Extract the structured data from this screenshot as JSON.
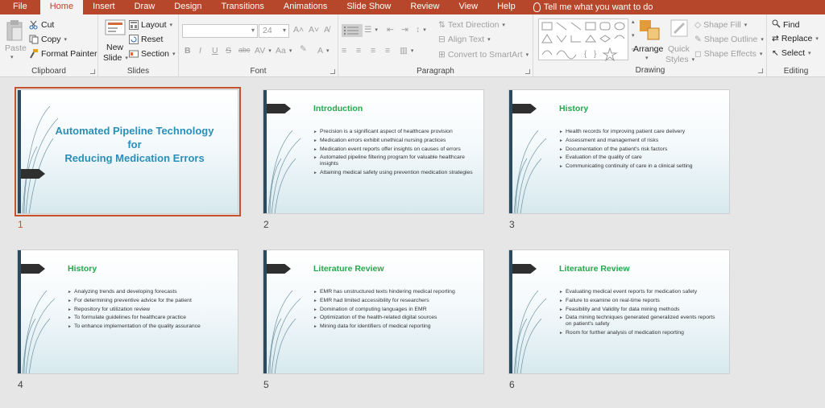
{
  "tabs": [
    "File",
    "Home",
    "Insert",
    "Draw",
    "Design",
    "Transitions",
    "Animations",
    "Slide Show",
    "Review",
    "View",
    "Help"
  ],
  "active_tab": "Home",
  "tell_me": "Tell me what you want to do",
  "clipboard": {
    "paste": "Paste",
    "cut": "Cut",
    "copy": "Copy",
    "format_painter": "Format Painter",
    "label": "Clipboard"
  },
  "slides_group": {
    "new_slide_1": "New",
    "new_slide_2": "Slide",
    "layout": "Layout",
    "reset": "Reset",
    "section": "Section",
    "label": "Slides"
  },
  "font": {
    "family_value": "",
    "size_value": "24",
    "label": "Font",
    "bold": "B",
    "italic": "I",
    "underline": "U",
    "strike": "S",
    "abc": "abc",
    "spacing": "AV",
    "case": "Aa",
    "color": "A"
  },
  "paragraph": {
    "text_direction": "Text Direction",
    "align_text": "Align Text",
    "convert_smartart": "Convert to SmartArt",
    "label": "Paragraph"
  },
  "drawing": {
    "arrange": "Arrange",
    "quick_styles_1": "Quick",
    "quick_styles_2": "Styles",
    "shape_fill": "Shape Fill",
    "shape_outline": "Shape Outline",
    "shape_effects": "Shape Effects",
    "label": "Drawing"
  },
  "editing": {
    "find": "Find",
    "replace": "Replace",
    "select": "Select",
    "label": "Editing"
  },
  "slides": [
    {
      "number": "1",
      "title_lines": [
        "Automated Pipeline Technology",
        "for",
        "Reducing Medication Errors"
      ],
      "selected": true
    },
    {
      "number": "2",
      "title": "Introduction",
      "bullets": [
        "Precision is a significant aspect of healthcare provision",
        "Medication errors exhibit unethical nursing practices",
        "Medication event reports offer insights on causes of errors",
        "Automated pipeline filtering program for valuable healthcare insights",
        "Attaining medical safety using prevention medication strategies"
      ]
    },
    {
      "number": "3",
      "title": "History",
      "bullets": [
        "Health records for improving patient care delivery",
        "Assessment and management of risks",
        "Documentation of the patient's risk factors",
        "Evaluation of the quality of care",
        "Communicating continuity of care in a clinical setting"
      ]
    },
    {
      "number": "4",
      "title": "History",
      "bullets": [
        "Analyzing trends and developing forecasts",
        "For determining preventive advice for the patient",
        "Repository for utilization review",
        "To formulate guidelines for healthcare practice",
        "To enhance implementation of the quality assurance"
      ]
    },
    {
      "number": "5",
      "title": "Literature Review",
      "bullets": [
        "EMR has unstructured texts hindering medical reporting",
        "EMR had limited accessibility for researchers",
        "Domination of computing languages in EMR",
        "Optimization of the health-related digital sources",
        "Mining data for identifiers of medical reporting"
      ]
    },
    {
      "number": "6",
      "title": "Literature Review",
      "bullets": [
        "Evaluating medical event reports for medication safety",
        "Failure to examine on real-time reports",
        "Feasibility and Validity for data mining methods",
        "Data mining techniques generated generalized events reports on patient's safety",
        "Room for further analysis of medication reporting"
      ]
    }
  ],
  "colors": {
    "accent": "#b7472a",
    "slide_title_green": "#22a94a",
    "title_blue": "#2a8fb8",
    "selection": "#c5512f"
  }
}
